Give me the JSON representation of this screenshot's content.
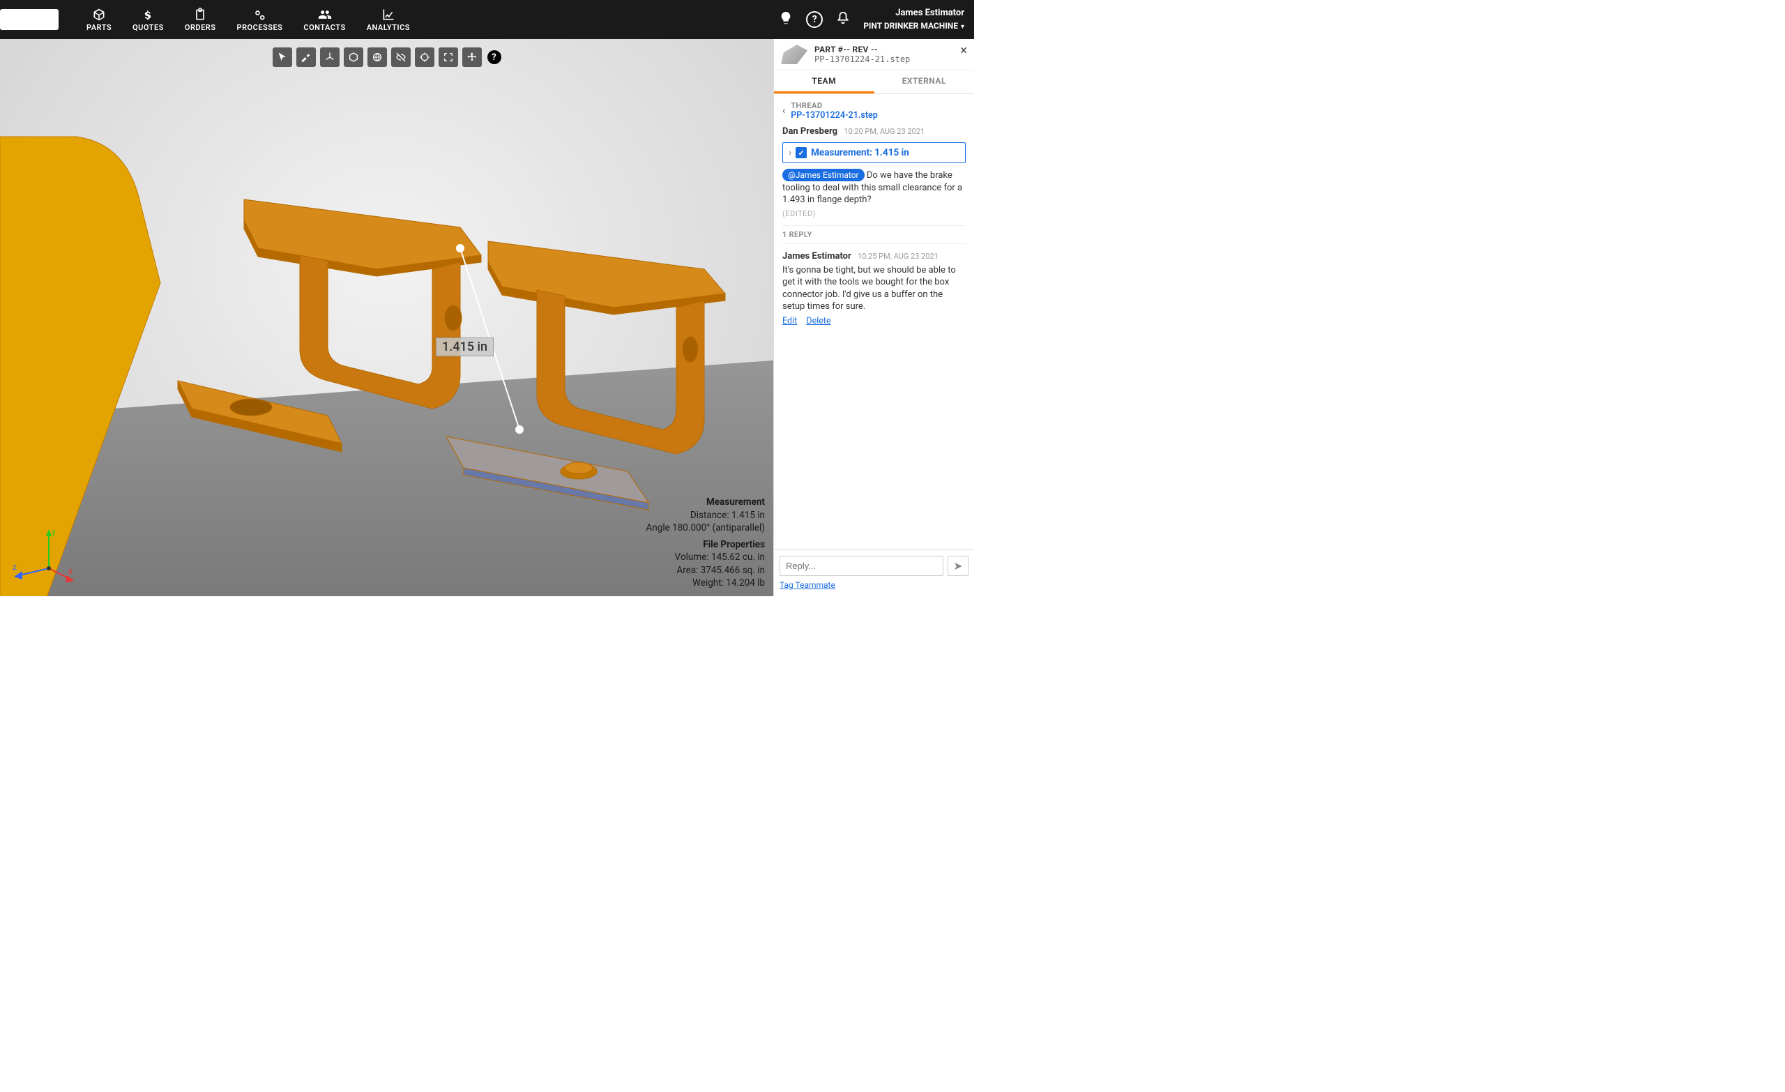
{
  "nav": {
    "items": [
      {
        "label": "PARTS"
      },
      {
        "label": "QUOTES"
      },
      {
        "label": "ORDERS"
      },
      {
        "label": "PROCESSES"
      },
      {
        "label": "CONTACTS"
      },
      {
        "label": "ANALYTICS"
      }
    ],
    "user_name": "James Estimator",
    "user_org": "PINT DRINKER MACHINE"
  },
  "viewer": {
    "measurement_label": "1.415 in",
    "info": {
      "measurement_heading": "Measurement",
      "distance": "Distance: 1.415 in",
      "angle": "Angle 180.000° (antiparallel)",
      "file_heading": "File Properties",
      "volume": "Volume: 145.62 cu. in",
      "area": "Area: 3745.466 sq. in",
      "weight": "Weight: 14.204 lb"
    },
    "axes": {
      "x": "x",
      "y": "y",
      "z": "z"
    }
  },
  "panel": {
    "part_title": "PART #-- REV --",
    "part_file": "PP-13701224-21.step",
    "tabs": {
      "team": "TEAM",
      "external": "EXTERNAL"
    },
    "thread": {
      "label": "THREAD",
      "filename": "PP-13701224-21.step"
    },
    "message": {
      "author": "Dan Presberg",
      "time": "10:20 PM, AUG 23 2021",
      "measurement_chip": "Measurement: 1.415 in",
      "mention": "@James Estimator",
      "body": "Do we have the brake tooling to deal with this small clearance for a 1.493 in flange depth?",
      "edited": "(EDITED)"
    },
    "replies_label": "1 REPLY",
    "reply": {
      "author": "James Estimator",
      "time": "10:25 PM, AUG 23 2021",
      "body": "It's gonna be tight, but we should be able to get it with the tools we bought for the box connector job. I'd give us a buffer on the setup times for sure.",
      "edit": "Edit",
      "delete": "Delete"
    },
    "compose": {
      "placeholder": "Reply...",
      "tag": "Tag Teammate"
    }
  }
}
